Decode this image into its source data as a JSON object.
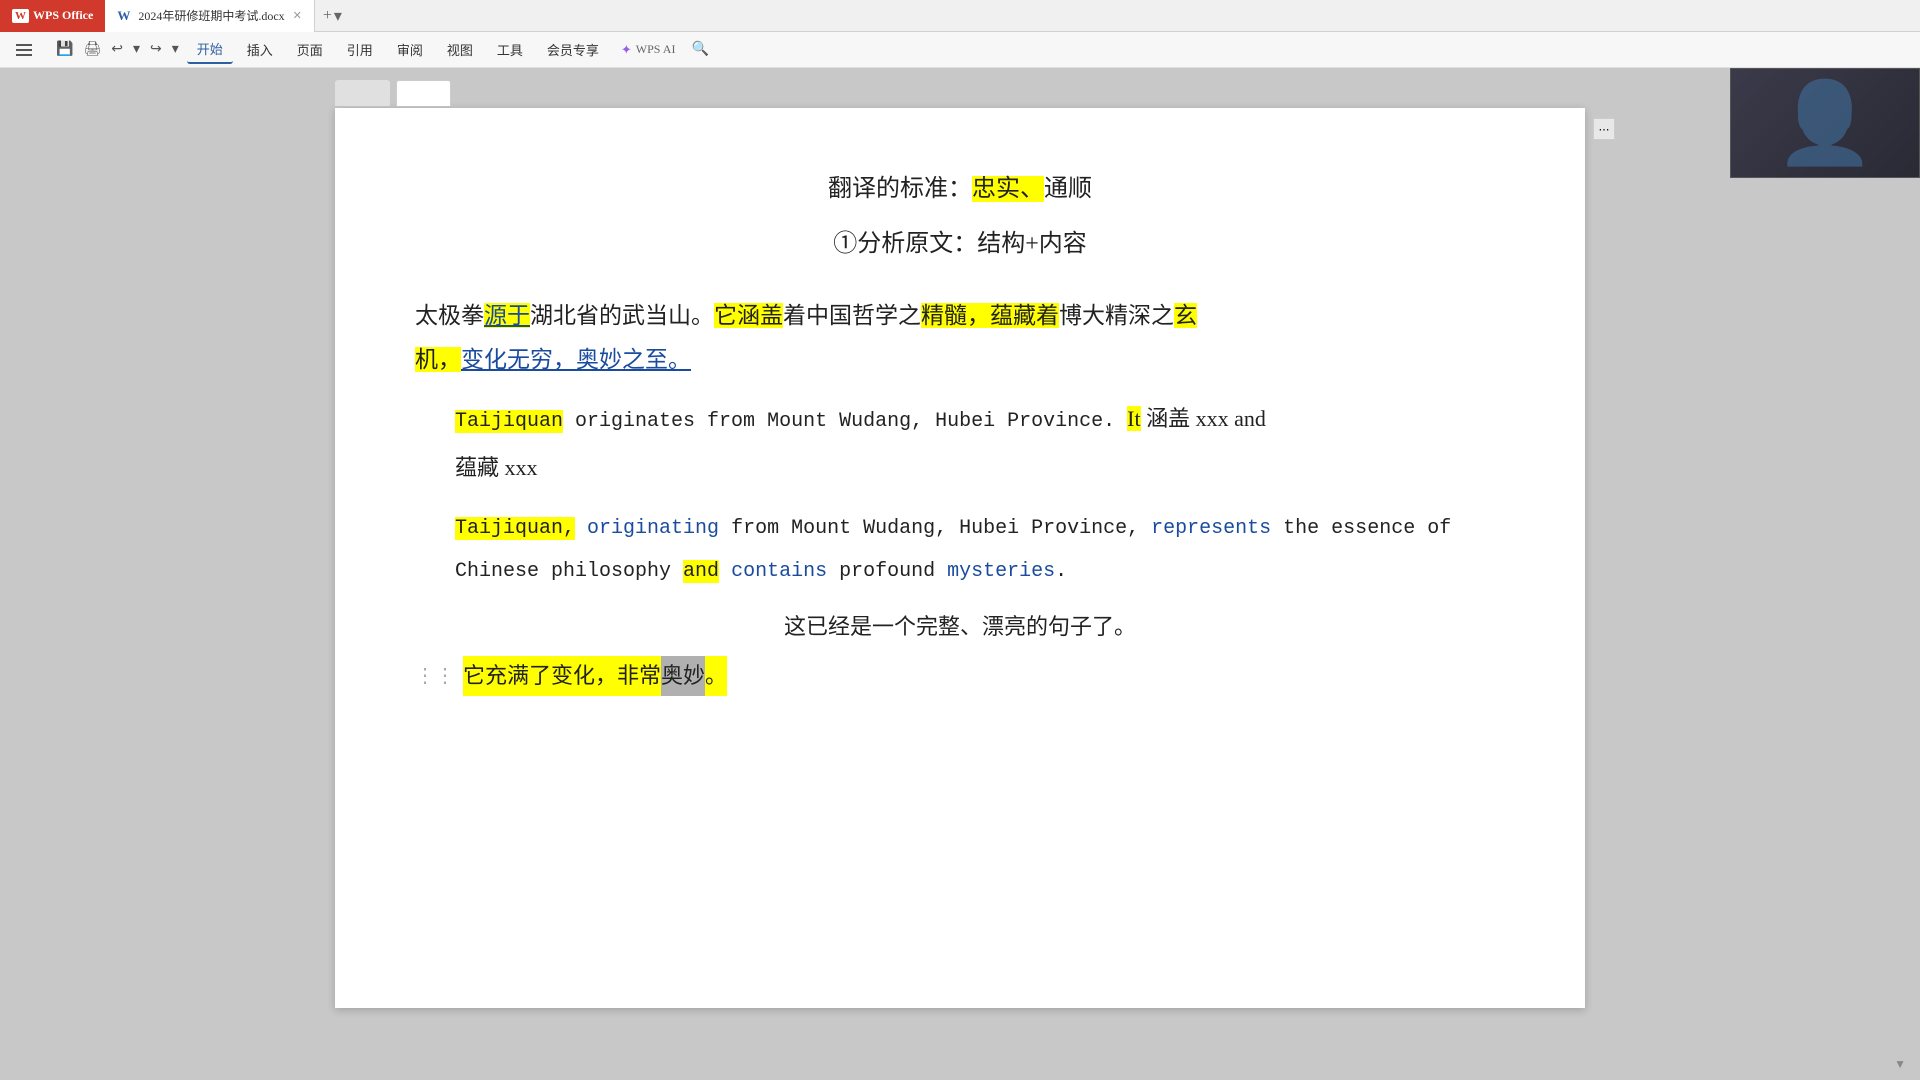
{
  "titlebar": {
    "wps_label": "WPS Office",
    "doc_title": "2024年研修班期中考试.docx",
    "new_tab_icon": "+",
    "chevron": "▾"
  },
  "menubar": {
    "file": "文件",
    "home": "开始",
    "insert": "插入",
    "page": "页面",
    "references": "引用",
    "review": "审阅",
    "view": "视图",
    "tools": "工具",
    "membership": "会员专享",
    "wps_ai": "WPS AI",
    "search_placeholder": "搜索"
  },
  "content": {
    "title1": "翻译的标准：",
    "title1_highlight1": "忠实、",
    "title1_rest": "通顺",
    "title2": "①分析原文：结构+内容",
    "chinese_para1_before": "太极拳",
    "chinese_para1_link": "源于",
    "chinese_para1_mid": "湖北省的武当山。",
    "chinese_para1_highlight2": "它涵盖",
    "chinese_para1_after": "着中国哲学之",
    "chinese_para1_highlight3": "精髓，蕴藏着",
    "chinese_para1_end": "博大精深之",
    "chinese_para1_highlight4": "玄",
    "chinese_para2_highlight": "机，",
    "chinese_para2_link": "变化无穷，奥妙之至。",
    "english_para1_highlight1": "Taijiquan",
    "english_para1_mid": " originates from Mount Wudang, Hubei Province. ",
    "english_para1_highlight2": "It",
    "english_para1_after": " 涵盖 xxx and",
    "english_para2_start": "蕴藏 xxx",
    "english_para3_highlight1": "Taijiquan,",
    "english_para3_blue1": " originating",
    "english_para3_mid": " from Mount Wudang, Hubei Province, ",
    "english_para3_blue2": "represents",
    "english_para3_after": " the essence of Chinese philosophy ",
    "english_para3_highlight2": "and",
    "english_para3_blue3": " contains",
    "english_para3_end": " profound ",
    "english_para3_blue4": "mysteries",
    "english_para3_period": ".",
    "note1": "这已经是一个完整、漂亮的句子了。",
    "bottom_highlight": "它充满了变化，非常",
    "bottom_highlight2": "奥妙",
    "bottom_end": "。"
  },
  "colors": {
    "yellow_highlight": "#ffff00",
    "yellow_highlight2": "#f5e300",
    "gray_highlight": "#b0b0b0",
    "blue_link": "#1a4b9e",
    "accent_blue": "#2e5fa3"
  }
}
